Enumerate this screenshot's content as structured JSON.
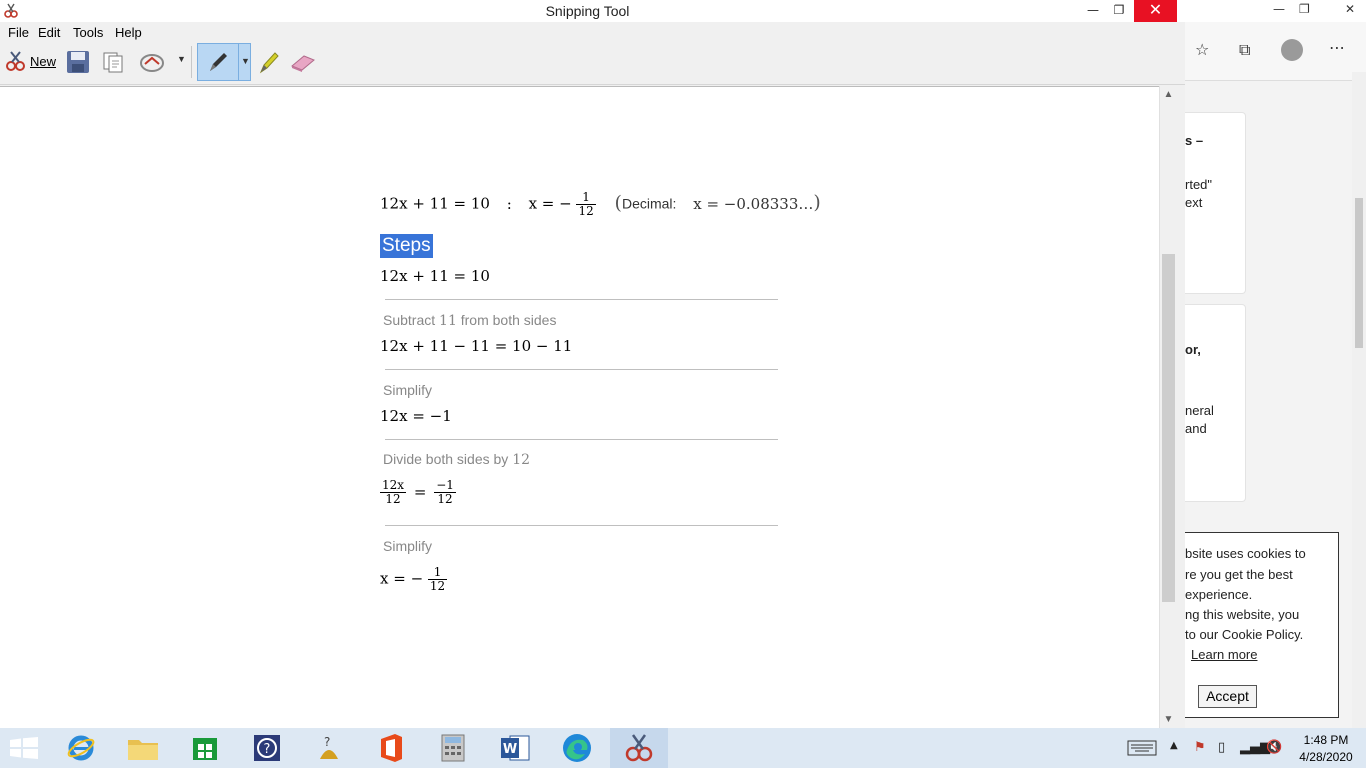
{
  "window": {
    "title": "Snipping Tool",
    "minimize": "—",
    "restore": "❐",
    "close": "✕"
  },
  "menu": [
    "File",
    "Edit",
    "Tools",
    "Help"
  ],
  "toolbar": {
    "new_label": "New"
  },
  "solution": {
    "answer_lhs": "12x + 11 = 10",
    "answer_sep": ":",
    "answer_var": "x = −",
    "answer_num": "1",
    "answer_den": "12",
    "decimal_label": "Decimal:",
    "decimal_value": "x = −0.08333…",
    "steps_title": "Steps",
    "step0_eq": "12x + 11 = 10",
    "step1_label_a": "Subtract",
    "step1_label_num": "11",
    "step1_label_b": "from both sides",
    "step1_eq": "12x + 11 − 11 = 10 − 11",
    "step2_label": "Simplify",
    "step2_eq": "12x =  −1",
    "step3_label_a": "Divide both sides by",
    "step3_label_num": "12",
    "step3_frac1_num": "12x",
    "step3_frac1_den": "12",
    "step3_eq_sign": "=",
    "step3_frac2_num": "−1",
    "step3_frac2_den": "12",
    "step4_label": "Simplify",
    "step4_lhs": "x =  −",
    "step4_num": "1",
    "step4_den": "12"
  },
  "background_browser": {
    "card1_lines": [
      "s –",
      "rted\"",
      "ext"
    ],
    "card2_lines": [
      "or,",
      "neral",
      " and"
    ],
    "cookie_lines": [
      "bsite uses cookies to",
      "re you get the best",
      " experience.",
      "ng this website, you",
      "to our Cookie Policy."
    ],
    "cookie_link": "Learn more",
    "accept_label": "Accept",
    "more_icon": "⋯"
  },
  "taskbar": {
    "time": "1:48 PM",
    "date": "4/28/2020"
  },
  "colors": {
    "selection": "#3874d8",
    "close_red": "#e81123",
    "taskbar": "#dde8f3"
  }
}
